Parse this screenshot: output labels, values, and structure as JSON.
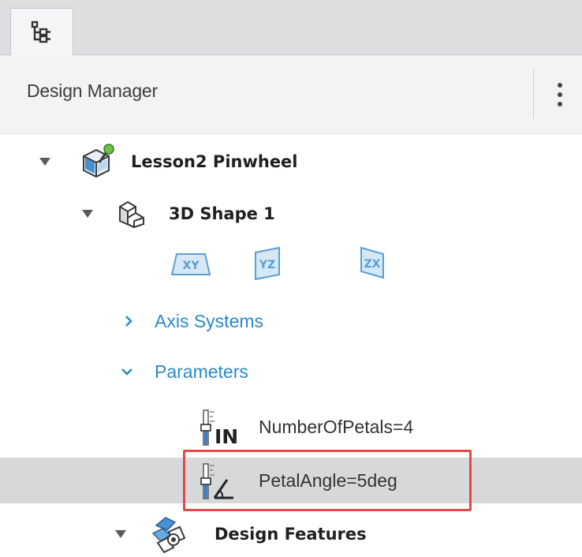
{
  "panel": {
    "tab_icon": "tree-icon",
    "title": "Design Manager",
    "menu_icon": "kebab-menu-icon"
  },
  "tree": {
    "root": {
      "label": "Lesson2 Pinwheel",
      "icon": "product-icon",
      "expanded": true
    },
    "shape": {
      "label": "3D Shape 1",
      "icon": "3d-shape-icon",
      "expanded": true
    },
    "planes": [
      {
        "label": "XY",
        "icon": "xy-plane-icon"
      },
      {
        "label": "YZ",
        "icon": "yz-plane-icon"
      },
      {
        "label": "ZX",
        "icon": "zx-plane-icon"
      }
    ],
    "axis_systems": {
      "label": "Axis Systems",
      "expanded": false
    },
    "parameters": {
      "label": "Parameters",
      "expanded": true,
      "items": [
        {
          "label": "NumberOfPetals=4",
          "icon": "integer-parameter-icon",
          "selected": false
        },
        {
          "label": "PetalAngle=5deg",
          "icon": "angle-parameter-icon",
          "selected": true
        }
      ]
    },
    "design_features": {
      "label": "Design Features",
      "icon": "design-features-icon",
      "expanded": true
    }
  },
  "colors": {
    "link": "#2c89c8",
    "selection": "#d6d8da",
    "highlight": "#e84848",
    "plane_blue": "#5a9fd4",
    "plane_fill": "#d6e8f6"
  }
}
